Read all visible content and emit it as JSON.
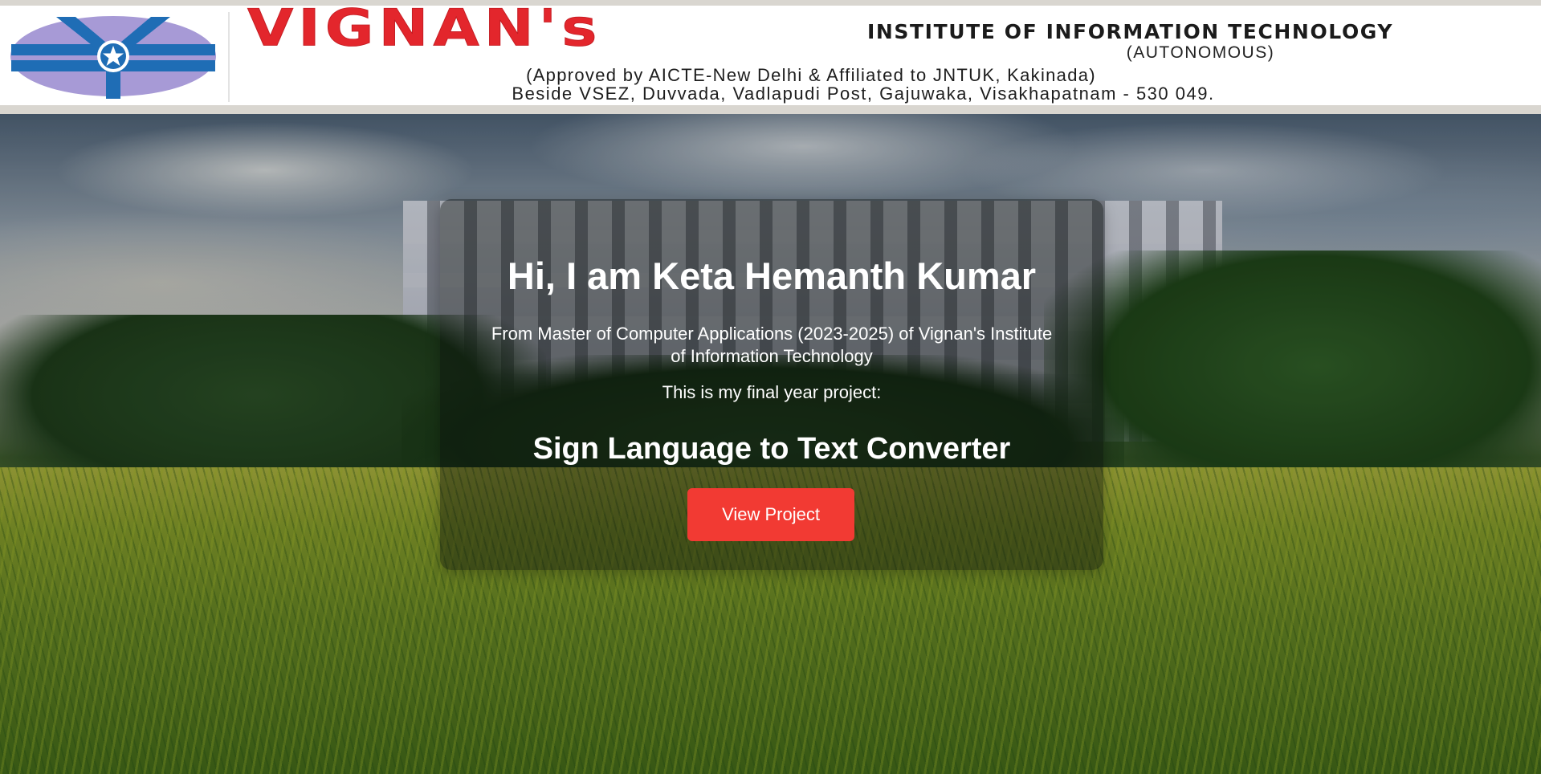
{
  "header": {
    "brand_name": "VIGNAN's",
    "institute_name": "INSTITUTE OF INFORMATION TECHNOLOGY",
    "status": "(AUTONOMOUS)",
    "approval": "(Approved by AICTE-New Delhi & Affiliated to JNTUK, Kakinada)",
    "address": "Beside VSEZ, Duvvada, Vadlapudi Post, Gajuwaka, Visakhapatnam - 530 049.",
    "logo_icon": "vignan-logo-icon",
    "brand_color": "#e3262c",
    "logo_colors": {
      "blue": "#1f6db5",
      "lavender": "#a79ad6"
    }
  },
  "hero": {
    "background": "campus-building-and-lawn-photo",
    "greeting": "Hi, I am Keta Hemanth Kumar",
    "program": "From Master of Computer Applications (2023-2025) of Vignan's Institute of Information Technology",
    "project_intro": "This is my final year project:",
    "project_title": "Sign Language to Text Converter",
    "cta_label": "View Project",
    "cta_color": "#f23a33"
  }
}
